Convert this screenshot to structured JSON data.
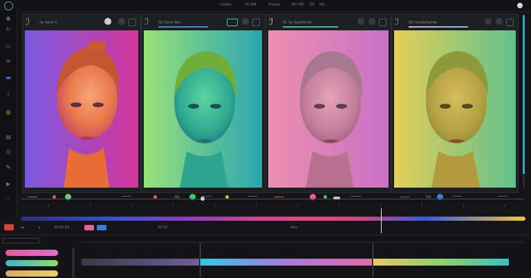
{
  "top_bar": {
    "titles": [
      "Celebs",
      "SO WE",
      "Onsela",
      "NO WE",
      "SA",
      "NG"
    ]
  },
  "panels": [
    {
      "title": "Sa Sand 3",
      "accent": "#e7e7ea"
    },
    {
      "title": "SD Sand Sen",
      "accent": "#3e8cd6"
    },
    {
      "title": "SC Sa SondOnds",
      "accent": "#41b9a9"
    },
    {
      "title": "SB Cande/Sande",
      "accent": "#e8a9c9"
    }
  ],
  "panel_footers": [
    {
      "label": "",
      "color": "#6ecf7a"
    },
    {
      "label": "NG",
      "color": "#3dcc6b"
    },
    {
      "label": "",
      "color": "#e8609a"
    },
    {
      "label": "NG",
      "color": "#3c7bd9"
    }
  ],
  "controls": {
    "timecode": "00:00.63",
    "marker": "00.50",
    "text_a": "Alas"
  },
  "tracks": [
    {
      "color": "#e5599a"
    },
    {
      "color": "#3bb6c8"
    },
    {
      "color": "#d8a85f"
    }
  ],
  "colors": {
    "panel_bg": "#1e1f22",
    "accent_blue": "#3c7bd9",
    "accent_pink": "#e8609a"
  }
}
